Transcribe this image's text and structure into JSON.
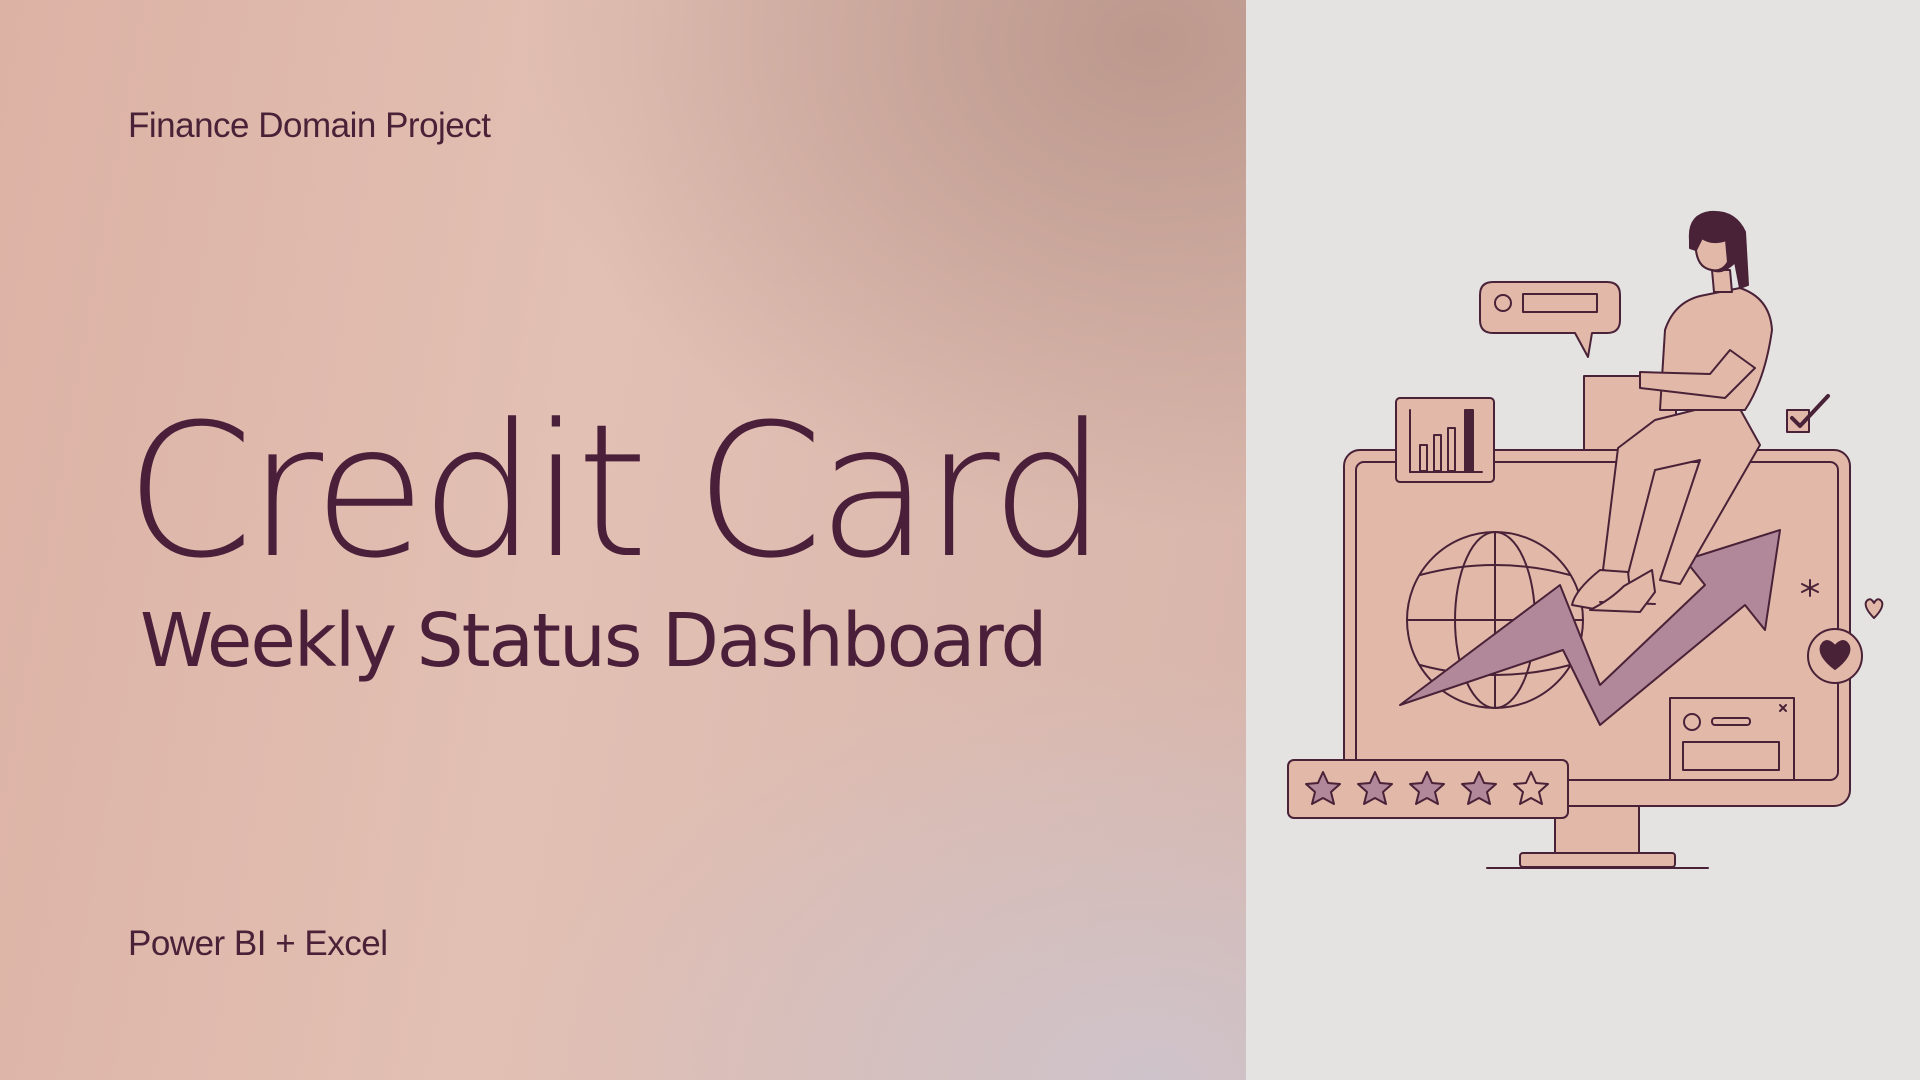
{
  "header": {
    "eyebrow": "Finance Domain Project"
  },
  "hero": {
    "title": "Credit Card",
    "subtitle": "Weekly Status Dashboard"
  },
  "footer": {
    "tools": "Power BI + Excel"
  },
  "illustration": {
    "rating_stars": 5,
    "icons": [
      "person-icon",
      "speech-bubble-icon",
      "bar-chart-icon",
      "checkbox-icon",
      "globe-icon",
      "trend-arrow-icon",
      "heart-icon",
      "sparkle-icon",
      "window-card-icon",
      "star-icon"
    ]
  },
  "colors": {
    "ink": "#4a1f3a",
    "panel_right": "#e4e3e1",
    "illustration_fill": "#e2b9a9",
    "arrow_fill": "#b0889a",
    "line": "#4a2238"
  }
}
